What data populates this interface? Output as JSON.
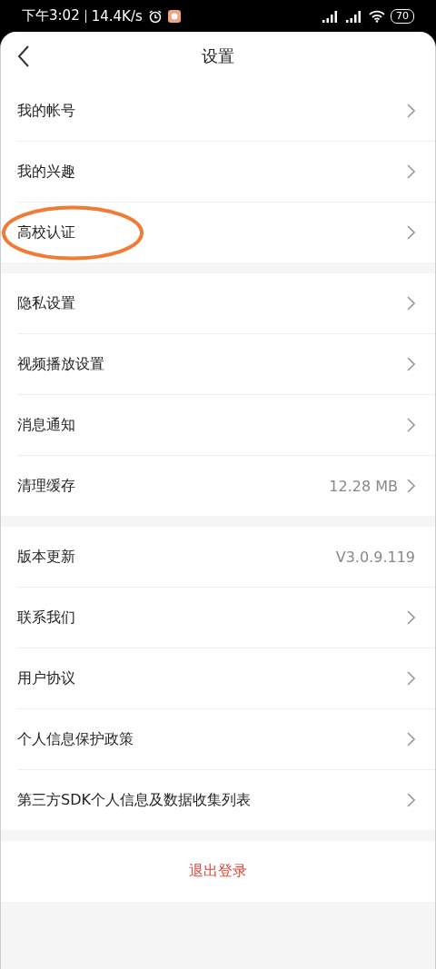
{
  "status_bar": {
    "time": "下午3:02",
    "speed": "14.4K/s",
    "battery": "70"
  },
  "header": {
    "title": "设置"
  },
  "groups": [
    {
      "items": [
        {
          "label": "我的帐号",
          "arrow": true,
          "circled": false
        },
        {
          "label": "我的兴趣",
          "arrow": true,
          "circled": false
        },
        {
          "label": "高校认证",
          "arrow": true,
          "circled": true
        }
      ]
    },
    {
      "items": [
        {
          "label": "隐私设置",
          "arrow": true,
          "circled": false
        },
        {
          "label": "视频播放设置",
          "arrow": true,
          "circled": false
        },
        {
          "label": "消息通知",
          "arrow": true,
          "circled": false
        },
        {
          "label": "清理缓存",
          "value": "12.28 MB",
          "arrow": true,
          "circled": false
        }
      ]
    },
    {
      "items": [
        {
          "label": "版本更新",
          "value": "V3.0.9.119",
          "arrow": false,
          "circled": false
        },
        {
          "label": "联系我们",
          "arrow": true,
          "circled": false
        },
        {
          "label": "用户协议",
          "arrow": true,
          "circled": false
        },
        {
          "label": "个人信息保护政策",
          "arrow": true,
          "circled": false
        },
        {
          "label": "第三方SDK个人信息及数据收集列表",
          "arrow": true,
          "circled": false
        }
      ]
    }
  ],
  "logout": {
    "label": "退出登录"
  }
}
